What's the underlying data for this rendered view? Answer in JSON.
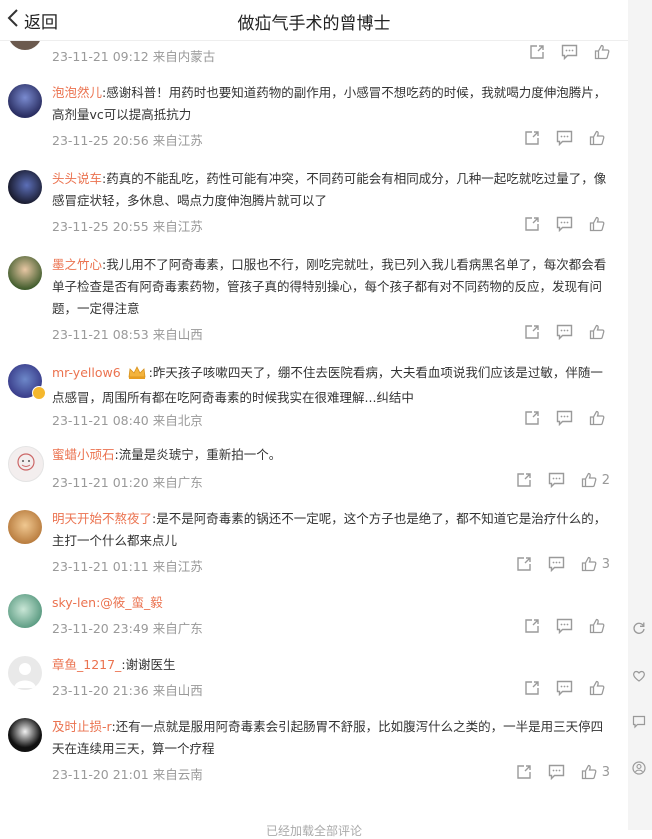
{
  "header": {
    "back_label": "返回",
    "title": "做疝气手术的曾博士"
  },
  "first_item": {
    "time": "23-11-21 09:12",
    "location": "来自内蒙古"
  },
  "comments": [
    {
      "user": "泡泡然儿",
      "text": ":感谢科普！用药时也要知道药物的副作用，小感冒不想吃药的时候，我就喝力度伸泡腾片，高剂量vc可以提高抵抗力",
      "time": "23-11-25 20:56",
      "location": "来自江苏",
      "likes": ""
    },
    {
      "user": "头头说车",
      "text": ":药真的不能乱吃，药性可能有冲突，不同药可能会有相同成分，几种一起吃就吃过量了，像感冒症状轻，多休息、喝点力度伸泡腾片就可以了",
      "time": "23-11-25 20:55",
      "location": "来自江苏",
      "likes": ""
    },
    {
      "user": "墨之竹心",
      "text": ":我儿用不了阿奇毒素，口服也不行，刚吃完就吐，我已列入我儿看病黑名单了，每次都会看单子检查是否有阿奇毒素药物，管孩子真的得特别操心，每个孩子都有对不同药物的反应，发现有问题，一定得注意",
      "time": "23-11-21 08:53",
      "location": "来自山西",
      "likes": ""
    },
    {
      "user": "mr-yellow6",
      "text": ":昨天孩子咳嗽四天了，绷不住去医院看病，大夫看血项说我们应该是过敏，伴随一点感冒，周围所有都在吃阿奇毒素的时候我实在很难理解...纠结中",
      "time": "23-11-21 08:40",
      "location": "来自北京",
      "likes": ""
    },
    {
      "user": "蜜蜡小顽石",
      "text": ":流量是炎琥宁，重新拍一个。",
      "time": "23-11-21 01:20",
      "location": "来自广东",
      "likes": "2"
    },
    {
      "user": "明天开始不熬夜了",
      "text": ":是不是阿奇毒素的锅还不一定呢，这个方子也是绝了，都不知道它是治疗什么的，主打一个什么都来点儿",
      "time": "23-11-21 01:11",
      "location": "来自江苏",
      "likes": "3"
    },
    {
      "user": "sky-len",
      "text": ":@筱_蛮_毅",
      "time": "23-11-20 23:49",
      "location": "来自广东",
      "likes": ""
    },
    {
      "user": "章鱼_1217_",
      "text": ":谢谢医生",
      "time": "23-11-20 21:36",
      "location": "来自山西",
      "likes": ""
    },
    {
      "user": "及时止损-r",
      "text": ":还有一点就是服用阿奇毒素会引起肠胃不舒服，比如腹泻什么之类的，一半是用三天停四天在连续用三天，算一个疗程",
      "time": "23-11-20 21:01",
      "location": "来自云南",
      "likes": "3"
    }
  ],
  "footer": {
    "text": "已经加载全部评论"
  },
  "colors": {
    "username": "#eb7350",
    "meta": "#999999",
    "icon": "#9a9a9a"
  }
}
